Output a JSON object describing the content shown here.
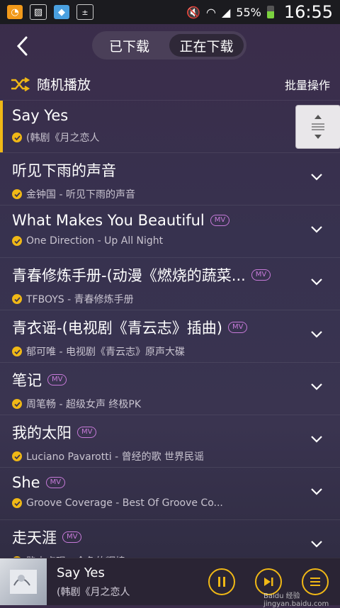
{
  "status_bar": {
    "battery": "55%",
    "time": "16:55",
    "icons": [
      "uc-browser-icon",
      "image-icon",
      "store-icon",
      "calculator-icon",
      "mute-icon",
      "wifi-icon",
      "signal-icon",
      "battery-icon"
    ]
  },
  "header": {
    "tabs": [
      {
        "label": "已下载",
        "active": false
      },
      {
        "label": "正在下载",
        "active": true
      }
    ]
  },
  "toolbar": {
    "shuffle_label": "随机播放",
    "batch_label": "批量操作"
  },
  "songs": [
    {
      "title": "Say Yes",
      "subtitle": "(韩剧《月之恋人",
      "mv": false,
      "selected": true
    },
    {
      "title": "听见下雨的声音",
      "subtitle": "金钟国 - 听见下雨的声音",
      "mv": false,
      "selected": false
    },
    {
      "title": "What Makes You Beautiful",
      "subtitle": "One Direction - Up All Night",
      "mv": true,
      "selected": false
    },
    {
      "title": "青春修炼手册-(动漫《燃烧的蔬菜...",
      "subtitle": "TFBOYS - 青春修炼手册",
      "mv": true,
      "selected": false
    },
    {
      "title": "青衣谣-(电视剧《青云志》插曲)",
      "subtitle": "郁可唯 - 电视剧《青云志》原声大碟",
      "mv": true,
      "selected": false
    },
    {
      "title": "笔记",
      "subtitle": "周笔畅 - 超级女声 终极PK",
      "mv": true,
      "selected": false
    },
    {
      "title": "我的太阳",
      "subtitle": "Luciano Pavarotti - 曾经的歌 世界民谣",
      "mv": true,
      "selected": false
    },
    {
      "title": "She",
      "subtitle": "Groove Coverage - Best Of Groove Co...",
      "mv": true,
      "selected": false
    },
    {
      "title": "走天涯",
      "subtitle": "路由点现 - 今色的辉煌",
      "mv": true,
      "selected": false
    }
  ],
  "mv_label": "MV",
  "player": {
    "title": "Say Yes",
    "subtitle": "(韩剧《月之恋人",
    "watermark": "Baidu 经验 jingyan.baidu.com"
  },
  "colors": {
    "accent": "#f0b816",
    "mv_badge": "#c77ad9",
    "background": "#37324f"
  }
}
